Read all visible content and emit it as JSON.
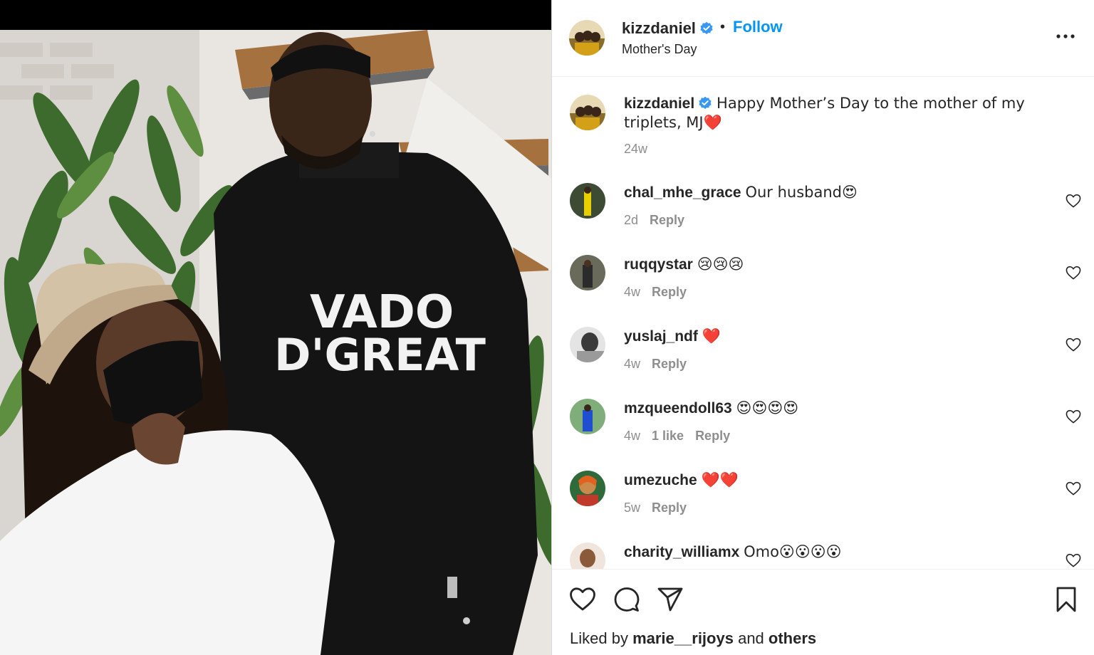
{
  "post": {
    "username": "kizzdaniel",
    "follow_label": "Follow",
    "separator": "•",
    "subtitle": "Mother's Day",
    "caption": "Happy Mother’s Day to the mother of my triplets, MJ❤️",
    "caption_age": "24w",
    "hoodie_text_line1": "VADO",
    "hoodie_text_line2": "D'GREAT"
  },
  "comments": [
    {
      "username": "chal_mhe_grace",
      "text": "Our husband😍",
      "age": "2d",
      "likes": "",
      "reply": "Reply"
    },
    {
      "username": "ruqqystar",
      "text": "😢😢😢",
      "age": "4w",
      "likes": "",
      "reply": "Reply"
    },
    {
      "username": "yuslaj_ndf",
      "text": "❤️",
      "age": "4w",
      "likes": "",
      "reply": "Reply"
    },
    {
      "username": "mzqueendoll63",
      "text": "😍😍😍😍",
      "age": "4w",
      "likes": "1 like",
      "reply": "Reply"
    },
    {
      "username": "umezuche",
      "text": "❤️❤️",
      "age": "5w",
      "likes": "",
      "reply": "Reply"
    },
    {
      "username": "charity_williamx",
      "text": "Omo😮😮😮😮",
      "age": "",
      "likes": "",
      "reply": ""
    }
  ],
  "footer": {
    "liked_by_prefix": "Liked by",
    "liked_by_user": "marie__rijoys",
    "liked_by_and": "and",
    "liked_by_others": "others"
  },
  "icons": {
    "verified": "verified-badge-icon",
    "more": "more-options-icon",
    "comment_like": "heart-outline-icon",
    "like": "heart-icon",
    "comment": "comment-bubble-icon",
    "share": "paper-plane-icon",
    "save": "bookmark-icon"
  },
  "colors": {
    "link": "#0095f6",
    "verified": "#3897f0",
    "text": "#262626",
    "muted": "#8e8e8e"
  }
}
